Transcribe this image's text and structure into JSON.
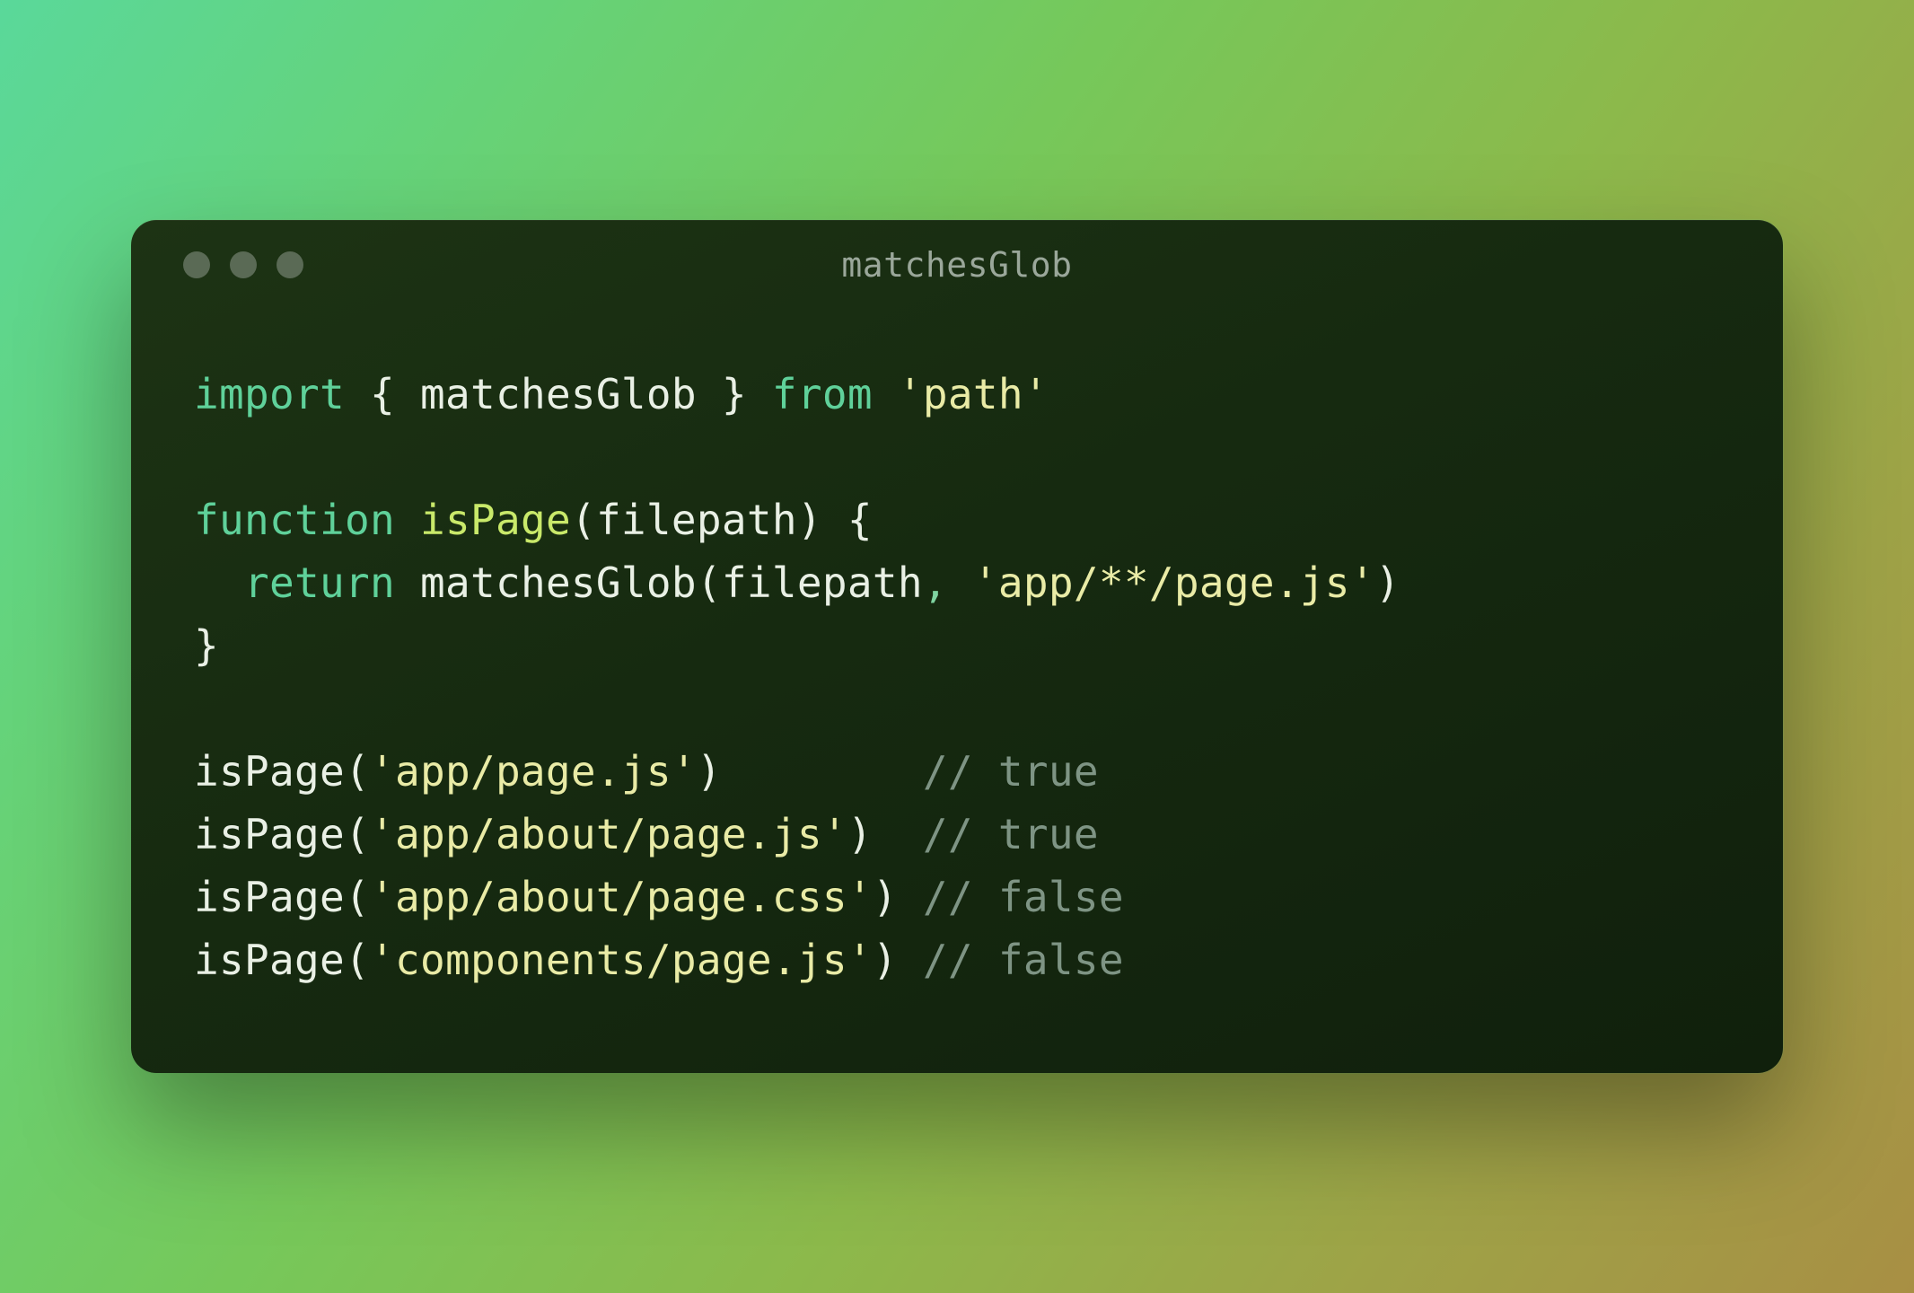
{
  "window": {
    "title": "matchesGlob"
  },
  "code": {
    "lines": [
      {
        "type": "import",
        "kw1": "import",
        "brace_open": "{",
        "symbol": "matchesGlob",
        "brace_close": "}",
        "kw2": "from",
        "module": "'path'"
      },
      {
        "type": "blank"
      },
      {
        "type": "fn_decl",
        "kw": "function",
        "name": "isPage",
        "open": "(",
        "param": "filepath",
        "close": ")",
        "brace": "{"
      },
      {
        "type": "return",
        "indent": "  ",
        "kw": "return",
        "callee": "matchesGlob",
        "open": "(",
        "arg1": "filepath",
        "comma": ",",
        "arg2": "'app/**/page.js'",
        "close": ")"
      },
      {
        "type": "close_brace",
        "brace": "}"
      },
      {
        "type": "blank"
      },
      {
        "type": "call_cmt",
        "callee": "isPage",
        "open": "(",
        "arg": "'app/page.js'",
        "close": ")",
        "pad": "       ",
        "cmt": "// true"
      },
      {
        "type": "call_cmt",
        "callee": "isPage",
        "open": "(",
        "arg": "'app/about/page.js'",
        "close": ")",
        "pad": " ",
        "cmt": "// true"
      },
      {
        "type": "call_cmt",
        "callee": "isPage",
        "open": "(",
        "arg": "'app/about/page.css'",
        "close": ")",
        "pad": "",
        "cmt": "// false"
      },
      {
        "type": "call_cmt",
        "callee": "isPage",
        "open": "(",
        "arg": "'components/page.js'",
        "close": ")",
        "pad": "",
        "cmt": "// false"
      }
    ]
  }
}
